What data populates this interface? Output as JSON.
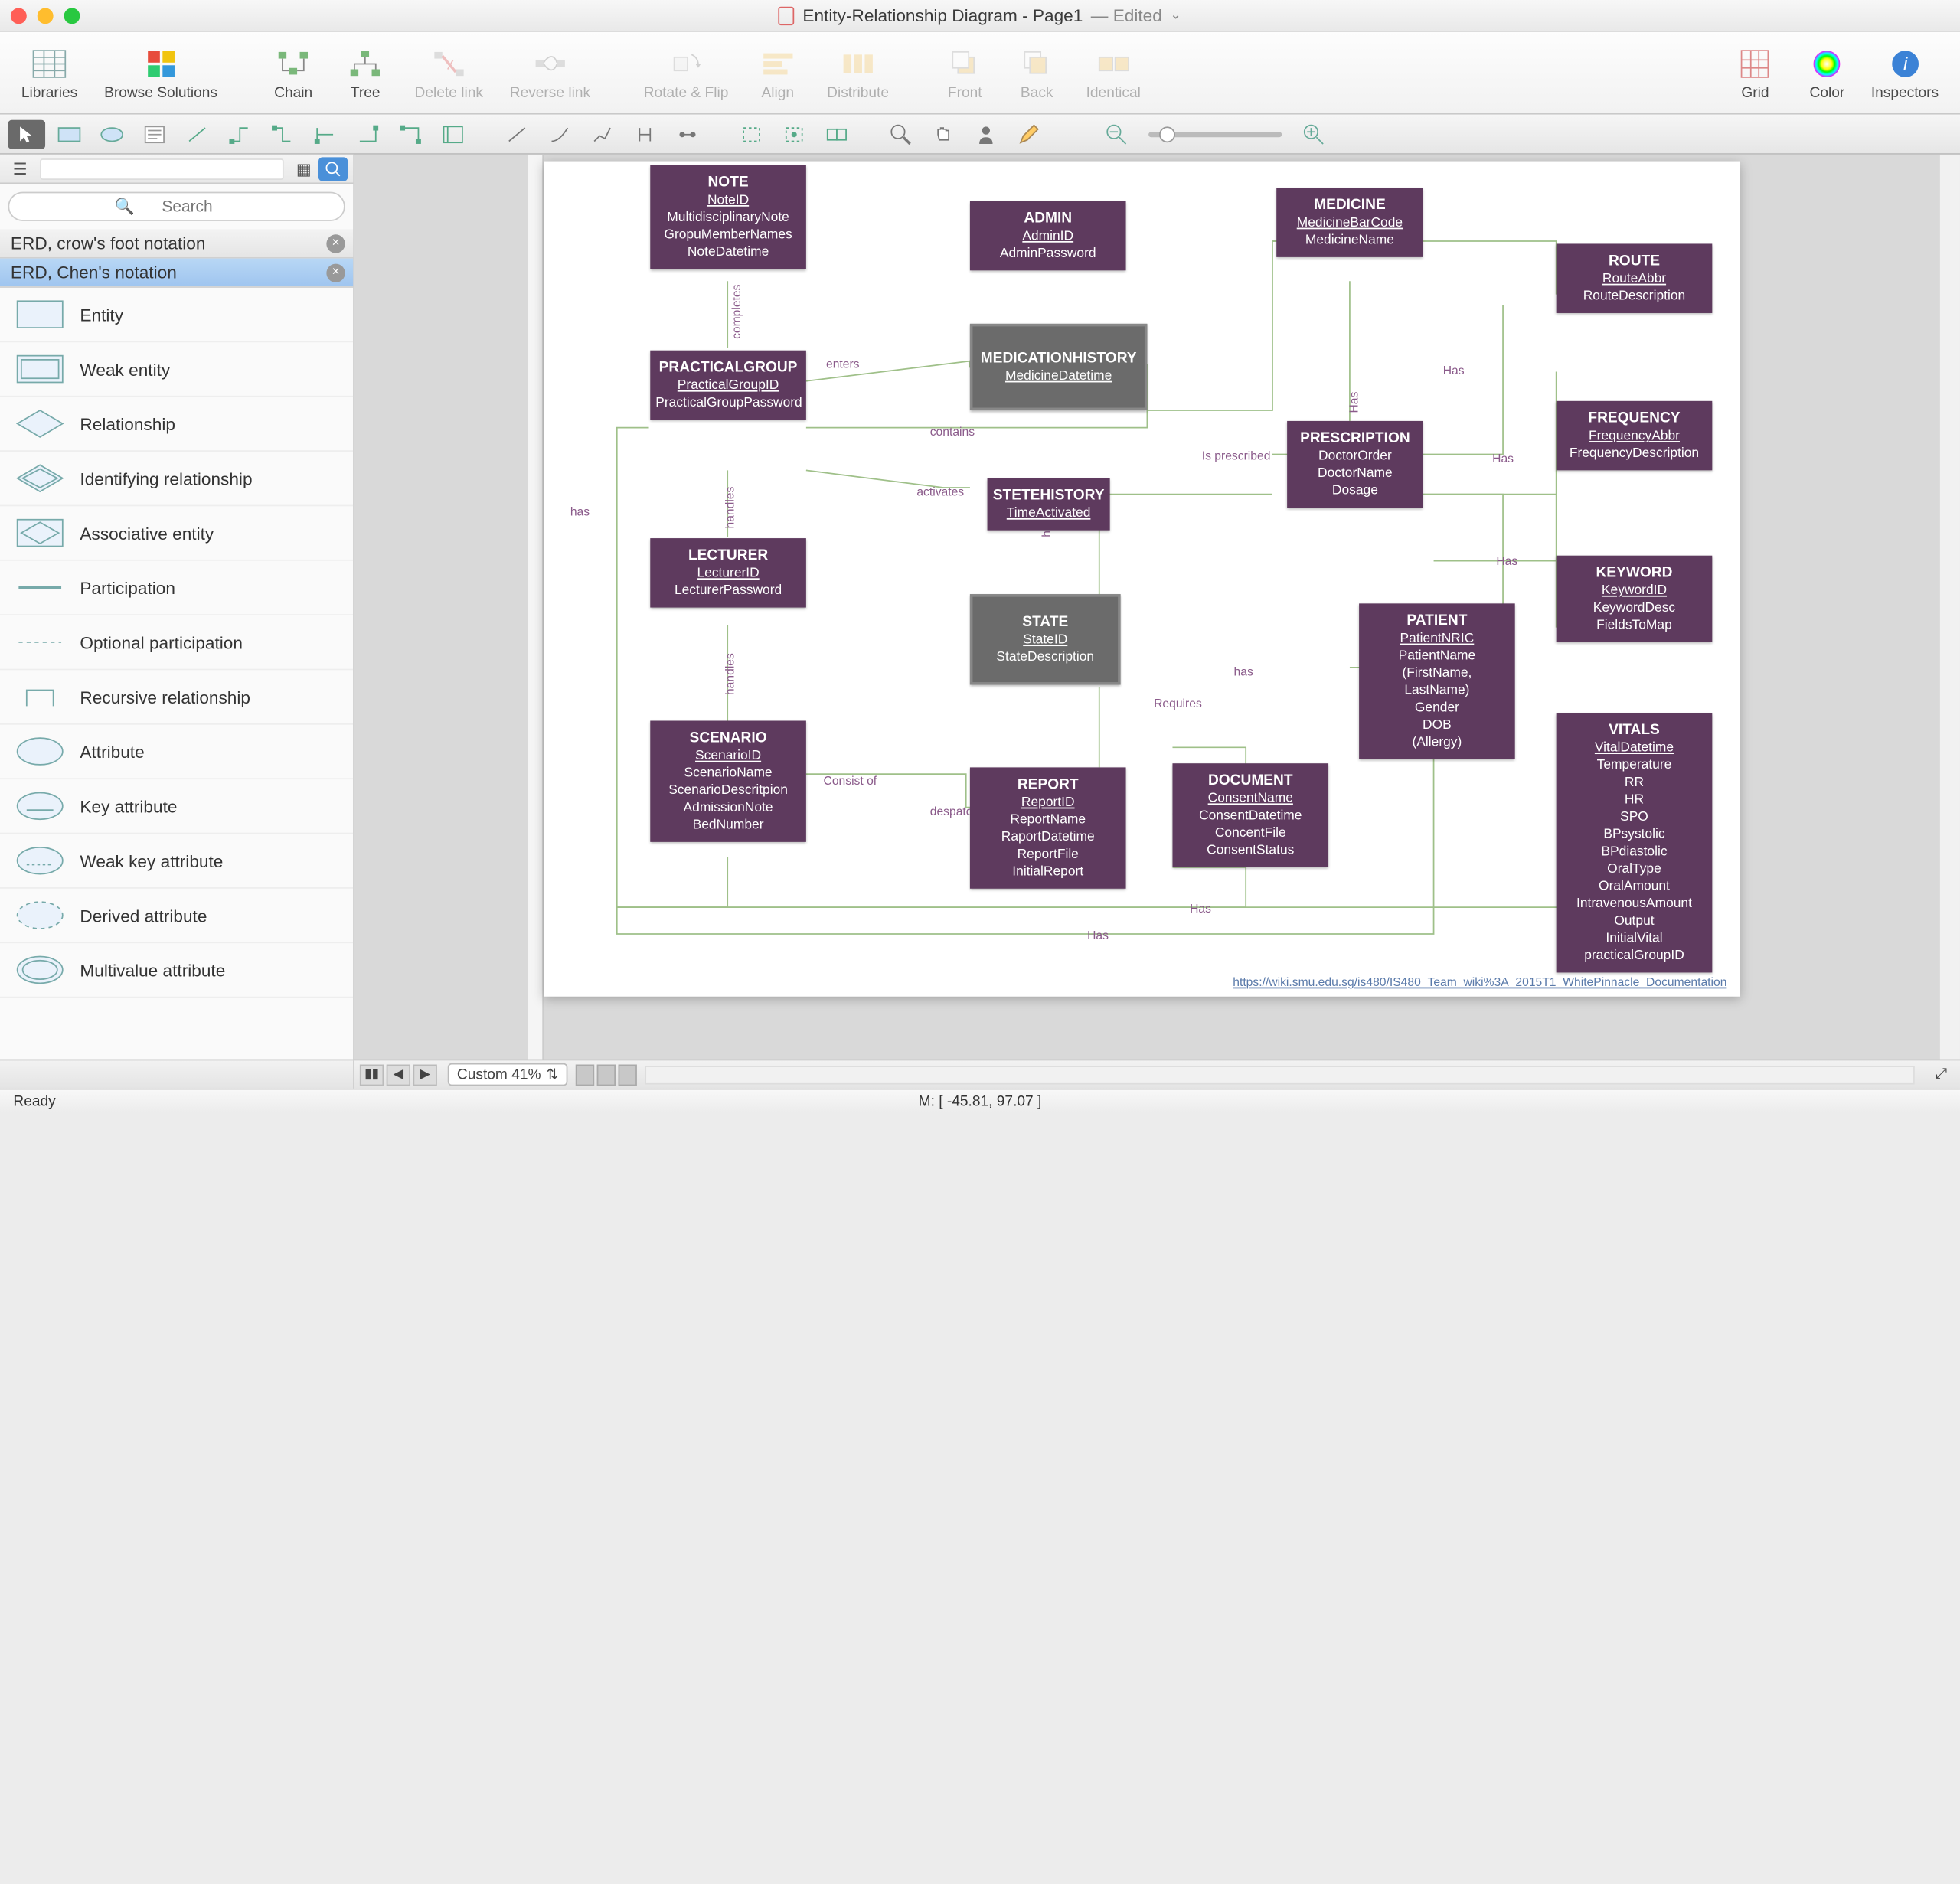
{
  "window": {
    "title_pre": "Entity-Relationship Diagram - Page1",
    "edited": "— Edited"
  },
  "toolbar": {
    "libraries": "Libraries",
    "browse": "Browse Solutions",
    "chain": "Chain",
    "tree": "Tree",
    "delete_link": "Delete link",
    "reverse_link": "Reverse link",
    "rotate_flip": "Rotate & Flip",
    "align": "Align",
    "distribute": "Distribute",
    "front": "Front",
    "back": "Back",
    "identical": "Identical",
    "grid": "Grid",
    "color": "Color",
    "inspectors": "Inspectors"
  },
  "search": {
    "placeholder": "Search"
  },
  "categories": [
    {
      "label": "ERD, crow's foot notation"
    },
    {
      "label": "ERD, Chen's notation"
    }
  ],
  "shapes": [
    "Entity",
    "Weak entity",
    "Relationship",
    "Identifying relationship",
    "Associative entity",
    "Participation",
    "Optional participation",
    "Recursive relationship",
    "Attribute",
    "Key attribute",
    "Weak key attribute",
    "Derived attribute",
    "Multivalue attribute"
  ],
  "entities": {
    "note": {
      "title": "NOTE",
      "lines": [
        "NoteID",
        "MultidisciplinaryNote",
        "GropuMemberNames",
        "NoteDatetime"
      ],
      "under": [
        0
      ]
    },
    "admin": {
      "title": "ADMIN",
      "lines": [
        "AdminID",
        "AdminPassword"
      ],
      "under": [
        0
      ]
    },
    "medicine": {
      "title": "MEDICINE",
      "lines": [
        "MedicineBarCode",
        "MedicineName"
      ],
      "under": [
        0
      ]
    },
    "route": {
      "title": "ROUTE",
      "lines": [
        "RouteAbbr",
        "RouteDescription"
      ],
      "under": [
        0
      ]
    },
    "medhist": {
      "title": "MEDICATIONHISTORY",
      "lines": [
        "MedicineDatetime"
      ],
      "under": [
        0
      ]
    },
    "pracgroup": {
      "title": "PRACTICALGROUP",
      "lines": [
        "PracticalGroupID",
        "PracticalGroupPassword"
      ],
      "under": [
        0
      ]
    },
    "prescription": {
      "title": "PRESCRIPTION",
      "lines": [
        "DoctorOrder",
        "DoctorName",
        "Dosage"
      ],
      "under": []
    },
    "frequency": {
      "title": "FREQUENCY",
      "lines": [
        "FrequencyAbbr",
        "FrequencyDescription"
      ],
      "under": [
        0
      ]
    },
    "stetehist": {
      "title": "STETEHISTORY",
      "lines": [
        "TimeActivated"
      ],
      "under": [
        0
      ]
    },
    "lecturer": {
      "title": "LECTURER",
      "lines": [
        "LecturerID",
        "LecturerPassword"
      ],
      "under": [
        0
      ]
    },
    "keyword": {
      "title": "KEYWORD",
      "lines": [
        "KeywordID",
        "KeywordDesc",
        "FieldsToMap"
      ],
      "under": [
        0
      ]
    },
    "state": {
      "title": "STATE",
      "lines": [
        "StateID",
        "StateDescription"
      ],
      "under": [
        0
      ]
    },
    "patient": {
      "title": "PATIENT",
      "lines": [
        "PatientNRIC",
        "PatientName",
        "(FirstName,",
        "LastName)",
        "Gender",
        "DOB",
        "(Allergy)"
      ],
      "under": [
        0
      ]
    },
    "scenario": {
      "title": "SCENARIO",
      "lines": [
        "ScenarioID",
        "ScenarioName",
        "ScenarioDescritpion",
        "AdmissionNote",
        "BedNumber"
      ],
      "under": [
        0
      ]
    },
    "report": {
      "title": "REPORT",
      "lines": [
        "ReportID",
        "ReportName",
        "RaportDatetime",
        "ReportFile",
        "InitialReport"
      ],
      "under": [
        0
      ]
    },
    "document": {
      "title": "DOCUMENT",
      "lines": [
        "ConsentName",
        "ConsentDatetime",
        "ConcentFile",
        "ConsentStatus"
      ],
      "under": [
        0
      ]
    },
    "vitals": {
      "title": "VITALS",
      "lines": [
        "VitalDatetime",
        "Temperature",
        "RR",
        "HR",
        "SPO",
        "BPsystolic",
        "BPdiastolic",
        "OralType",
        "OralAmount",
        "IntravenousAmount",
        "Output",
        "InitialVital",
        "practicalGroupID"
      ],
      "under": [
        0
      ]
    }
  },
  "conn_labels": {
    "completes": "completes",
    "enters": "enters",
    "has1": "has",
    "activates": "activates",
    "contains": "contains",
    "handles": "handles",
    "handles2": "handles",
    "isprescribed": "Is prescribed",
    "has2": "Has",
    "has3": "Has",
    "has4": "Has",
    "has5": "has",
    "has6": "has",
    "requires": "Requires",
    "consistof": "Consist of",
    "despatch": "despatch",
    "has7": "Has",
    "has8": "Has",
    "has9": "Has"
  },
  "wiki": "https://wiki.smu.edu.sg/is480/IS480_Team_wiki%3A_2015T1_WhitePinnacle_Documentation",
  "bottom": {
    "zoom": "Custom 41%"
  },
  "status": {
    "ready": "Ready",
    "coords": "M: [ -45.81, 97.07 ]"
  }
}
